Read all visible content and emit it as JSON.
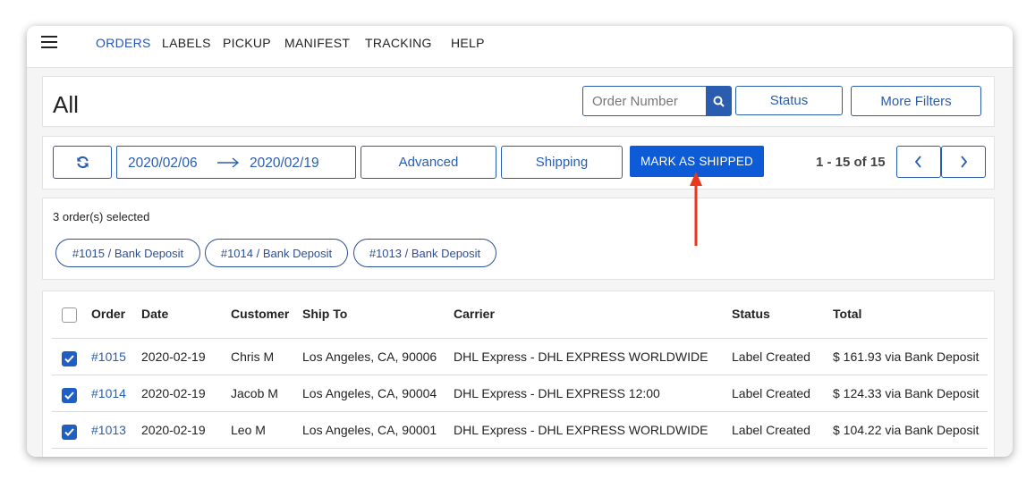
{
  "nav": {
    "items": [
      "ORDERS",
      "LABELS",
      "PICKUP",
      "MANIFEST",
      "TRACKING",
      "HELP"
    ],
    "active_index": 0
  },
  "header": {
    "title": "All",
    "search_placeholder": "Order Number",
    "status_label": "Status",
    "more_filters_label": "More Filters"
  },
  "toolbar": {
    "date_from": "2020/02/06",
    "date_to": "2020/02/19",
    "advanced_label": "Advanced",
    "shipping_label": "Shipping",
    "mark_shipped_label": "MARK AS SHIPPED",
    "pagination_text": "1 - 15 of 15"
  },
  "selection": {
    "summary": "3 order(s) selected",
    "chips": [
      "#1015 / Bank Deposit",
      "#1014 / Bank Deposit",
      "#1013 / Bank Deposit"
    ]
  },
  "table": {
    "headers": [
      "Order",
      "Date",
      "Customer",
      "Ship To",
      "Carrier",
      "Status",
      "Total"
    ],
    "rows": [
      {
        "order": "#1015",
        "date": "2020-02-19",
        "customer": "Chris M",
        "ship_to": "Los Angeles, CA, 90006",
        "carrier": "DHL Express - DHL EXPRESS WORLDWIDE",
        "status": "Label Created",
        "total": "$ 161.93 via Bank Deposit",
        "checked": true
      },
      {
        "order": "#1014",
        "date": "2020-02-19",
        "customer": "Jacob M",
        "ship_to": "Los Angeles, CA, 90004",
        "carrier": "DHL Express - DHL EXPRESS 12:00",
        "status": "Label Created",
        "total": "$ 124.33 via Bank Deposit",
        "checked": true
      },
      {
        "order": "#1013",
        "date": "2020-02-19",
        "customer": "Leo M",
        "ship_to": "Los Angeles, CA, 90001",
        "carrier": "DHL Express - DHL EXPRESS WORLDWIDE",
        "status": "Label Created",
        "total": "$ 104.22 via Bank Deposit",
        "checked": true
      }
    ]
  },
  "icons": {
    "menu": "hamburger-icon",
    "search": "search-icon",
    "refresh": "refresh-icon",
    "arrow": "arrow-right-icon",
    "prev": "chevron-left-icon",
    "next": "chevron-right-icon",
    "check": "checkmark-icon",
    "annotation": "arrow-up-icon"
  },
  "colors": {
    "accent": "#2a5db0",
    "primary_button": "#0d5bd7",
    "annotation_arrow": "#e8371d"
  }
}
